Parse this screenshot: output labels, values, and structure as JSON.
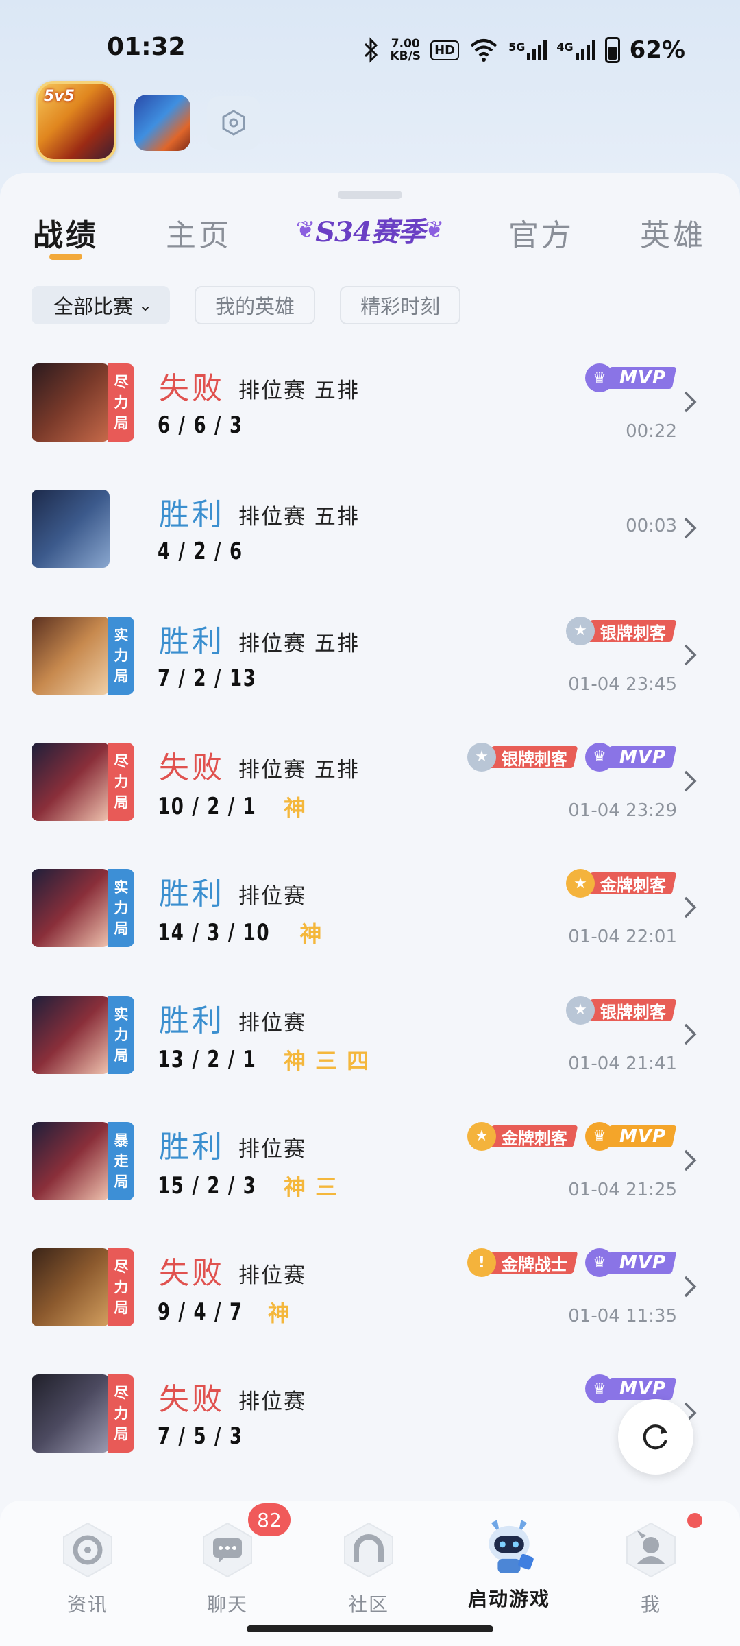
{
  "status_bar": {
    "time": "01:32",
    "net_speed_value": "7.00",
    "net_speed_unit": "KB/S",
    "hd_label": "HD",
    "signal_5g": "5G",
    "signal_4g": "4G",
    "battery": "62%"
  },
  "tabs": [
    {
      "label": "战绩",
      "active": true
    },
    {
      "label": "主页",
      "active": false
    },
    {
      "label": "S34赛季",
      "active": false
    },
    {
      "label": "官方",
      "active": false
    },
    {
      "label": "英雄",
      "active": false
    }
  ],
  "filters": {
    "all_matches": "全部比赛",
    "my_heroes": "我的英雄",
    "highlights": "精彩时刻"
  },
  "matches": [
    {
      "result": "失败",
      "outcome": "lose",
      "mode": "排位赛 五排",
      "kda": "6/6/3",
      "honors": [],
      "badges": [
        "MVP"
      ],
      "time": "00:22",
      "tag": "尽力局",
      "tag_color": "#e85a57",
      "avatar_colors": [
        "#2a1a1e",
        "#7a3a2a",
        "#c76a4a"
      ]
    },
    {
      "result": "胜利",
      "outcome": "win",
      "mode": "排位赛 五排",
      "kda": "4/2/6",
      "honors": [],
      "badges": [],
      "time": "00:03",
      "tag": "",
      "tag_color": "",
      "avatar_colors": [
        "#1d2a4a",
        "#3c5a8c",
        "#8aa7cf"
      ]
    },
    {
      "result": "胜利",
      "outcome": "win",
      "mode": "排位赛 五排",
      "kda": "7/2/13",
      "honors": [],
      "badges": [
        "银牌刺客"
      ],
      "time": "01-04 23:45",
      "tag": "实力局",
      "tag_color": "#3d8fd6",
      "avatar_colors": [
        "#5a3020",
        "#c7894e",
        "#f0d0a8"
      ]
    },
    {
      "result": "失败",
      "outcome": "lose",
      "mode": "排位赛 五排",
      "kda": "10/2/1",
      "honors": [
        "神"
      ],
      "badges": [
        "银牌刺客",
        "MVP"
      ],
      "time": "01-04 23:29",
      "tag": "尽力局",
      "tag_color": "#e85a57",
      "avatar_colors": [
        "#1e1f3a",
        "#8a2f3a",
        "#f0c4b0"
      ]
    },
    {
      "result": "胜利",
      "outcome": "win",
      "mode": "排位赛",
      "kda": "14/3/10",
      "honors": [
        "神"
      ],
      "badges": [
        "金牌刺客"
      ],
      "time": "01-04 22:01",
      "tag": "实力局",
      "tag_color": "#3d8fd6",
      "avatar_colors": [
        "#1e1f3a",
        "#8a2f3a",
        "#f0c4b0"
      ]
    },
    {
      "result": "胜利",
      "outcome": "win",
      "mode": "排位赛",
      "kda": "13/2/1",
      "honors": [
        "神",
        "三",
        "四"
      ],
      "badges": [
        "银牌刺客"
      ],
      "time": "01-04 21:41",
      "tag": "实力局",
      "tag_color": "#3d8fd6",
      "avatar_colors": [
        "#1e1f3a",
        "#8a2f3a",
        "#f0c4b0"
      ]
    },
    {
      "result": "胜利",
      "outcome": "win",
      "mode": "排位赛",
      "kda": "15/2/3",
      "honors": [
        "神",
        "三"
      ],
      "badges": [
        "金牌刺客",
        "MVP-gold"
      ],
      "time": "01-04 21:25",
      "tag": "暴走局",
      "tag_color": "#3d8fd6",
      "avatar_colors": [
        "#1e1f3a",
        "#8a2f3a",
        "#f0c4b0"
      ]
    },
    {
      "result": "失败",
      "outcome": "lose",
      "mode": "排位赛",
      "kda": "9/4/7",
      "honors": [
        "神"
      ],
      "badges": [
        "金牌战士",
        "MVP"
      ],
      "time": "01-04 11:35",
      "tag": "尽力局",
      "tag_color": "#e85a57",
      "avatar_colors": [
        "#3a2418",
        "#8c5a2e",
        "#d4a060"
      ]
    },
    {
      "result": "失败",
      "outcome": "lose",
      "mode": "排位赛",
      "kda": "7/5/3",
      "honors": [],
      "badges": [
        "MVP"
      ],
      "time": "01-04",
      "tag": "尽力局",
      "tag_color": "#e85a57",
      "avatar_colors": [
        "#20202a",
        "#4c4a60",
        "#9a9ab0"
      ]
    }
  ],
  "badge_labels": {
    "MVP": "MVP",
    "MVP-gold": "MVP",
    "银牌刺客": "银牌刺客",
    "金牌刺客": "金牌刺客",
    "金牌战士": "金牌战士"
  },
  "bottom_nav": [
    {
      "label": "资讯",
      "icon": "news-icon",
      "active": false
    },
    {
      "label": "聊天",
      "icon": "chat-icon",
      "active": false
    },
    {
      "label": "社区",
      "icon": "community-icon",
      "active": false
    },
    {
      "label": "启动游戏",
      "icon": "launch-game-icon",
      "active": true
    },
    {
      "label": "我",
      "icon": "profile-icon",
      "active": false
    }
  ],
  "chat_badge_count": "82",
  "colors": {
    "win": "#3b8fcf",
    "lose": "#e0524f",
    "honor": "#f4b73c",
    "accent_underline": "#f2a93b",
    "season_purple": "#6a3fc4"
  }
}
